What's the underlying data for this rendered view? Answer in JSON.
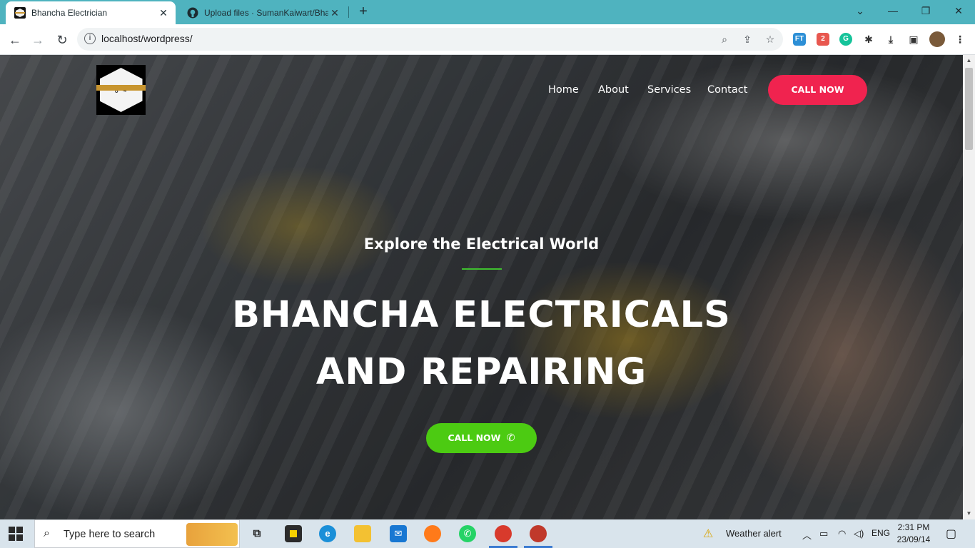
{
  "browser": {
    "tabs": [
      {
        "title": "Bhancha Electrician",
        "active": true,
        "icon": "site-logo-icon"
      },
      {
        "title": "Upload files · SumanKaiwart/Bhan",
        "active": false,
        "icon": "github-icon"
      }
    ],
    "url": "localhost/wordpress/",
    "extension_badge": "2"
  },
  "site": {
    "logo_alt": "Bhancha Electrician",
    "nav": [
      "Home",
      "About",
      "Services",
      "Contact"
    ],
    "call_now_top": "CALL NOW",
    "tagline": "Explore the Electrical World",
    "headline_line1": "BHANCHA ELECTRICALS",
    "headline_line2": "AND REPAIRING",
    "call_now_hero": "CALL NOW",
    "colors": {
      "call_top": "#f0234f",
      "call_hero": "#4ccb12",
      "divider": "#3fbf2f"
    }
  },
  "taskbar": {
    "search_placeholder": "Type here to search",
    "weather": "Weather alert",
    "language": "ENG",
    "time": "2:31 PM",
    "date": "23/09/14"
  }
}
